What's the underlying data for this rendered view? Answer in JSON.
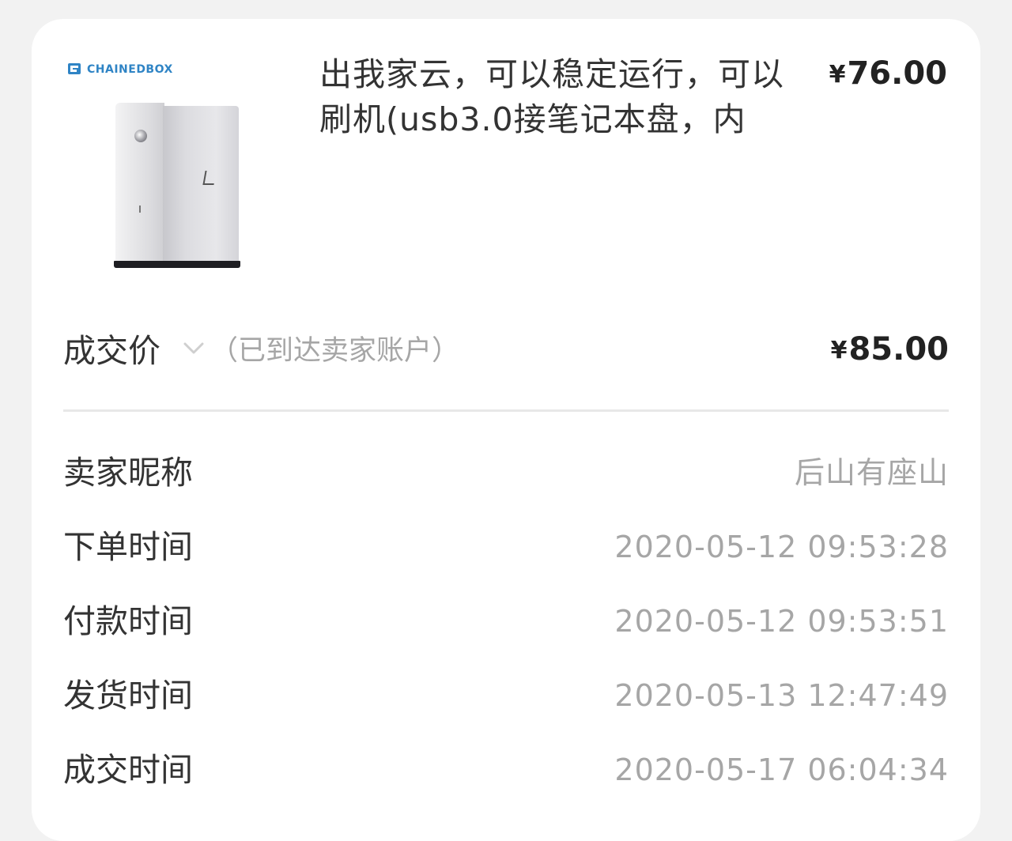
{
  "product": {
    "brand": "CHAINEDBOX",
    "title": "出我家云，可以稳定运行，可以刷机(usb3.0接笔记本盘，内",
    "price": "76.00",
    "currency_symbol": "¥"
  },
  "deal": {
    "label": "成交价",
    "note": "（已到达卖家账户）",
    "price": "85.00",
    "currency_symbol": "¥",
    "toggle_icon": "chevron-down-icon"
  },
  "info": [
    {
      "label": "卖家昵称",
      "value": "后山有座山"
    },
    {
      "label": "下单时间",
      "value": "2020-05-12 09:53:28"
    },
    {
      "label": "付款时间",
      "value": "2020-05-12 09:53:51"
    },
    {
      "label": "发货时间",
      "value": "2020-05-13 12:47:49"
    },
    {
      "label": "成交时间",
      "value": "2020-05-17 06:04:34"
    }
  ],
  "colors": {
    "background": "#f2f2f2",
    "card": "#ffffff",
    "primary_text": "#333333",
    "muted_text": "#a6a6a6",
    "brand": "#2f84c5"
  }
}
